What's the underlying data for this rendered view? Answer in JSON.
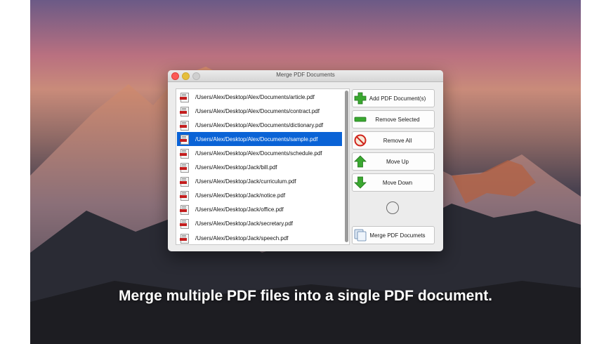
{
  "window": {
    "title": "Merge PDF Documents"
  },
  "files": [
    "/Users/Alex/Desktop/Alex/Documents/article.pdf",
    "/Users/Alex/Desktop/Alex/Documents/contract.pdf",
    "/Users/Alex/Desktop/Alex/Documents/dictionary.pdf",
    "/Users/Alex/Desktop/Alex/Documents/sample.pdf",
    "/Users/Alex/Desktop/Alex/Documents/schedule.pdf",
    "/Users/Alex/Desktop/Jack/bill.pdf",
    "/Users/Alex/Desktop/Jack/curriculum.pdf",
    "/Users/Alex/Desktop/Jack/notice.pdf",
    "/Users/Alex/Desktop/Jack/office.pdf",
    "/Users/Alex/Desktop/Jack/secretary.pdf",
    "/Users/Alex/Desktop/Jack/speech.pdf"
  ],
  "selected_index": 3,
  "buttons": {
    "add": "Add PDF Document(s)",
    "remove_selected": "Remove Selected",
    "remove_all": "Remove All",
    "move_up": "Move Up",
    "move_down": "Move Down",
    "merge": "Merge PDF Documets"
  },
  "caption": "Merge multiple PDF files into a single PDF document.",
  "colors": {
    "selection": "#0a63d6",
    "green_icon": "#3aa830",
    "red_icon": "#d0241c"
  }
}
